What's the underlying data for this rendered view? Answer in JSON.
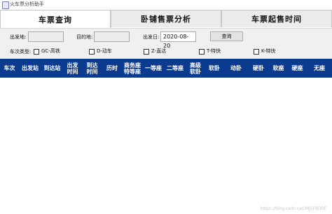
{
  "window": {
    "title": "火车票分析助手"
  },
  "tabs": [
    {
      "label": "车票查询",
      "active": true
    },
    {
      "label": "卧铺售票分析",
      "active": false
    },
    {
      "label": "车票起售时间",
      "active": false
    }
  ],
  "query": {
    "from_label": "出发地:",
    "from_value": "",
    "to_label": "目的地:",
    "to_value": "",
    "date_label": "出发日:",
    "date_value": "2020-08-20",
    "search_button": "查询",
    "type_label": "车次类型:",
    "train_types": [
      {
        "label": "GC-高铁",
        "checked": false
      },
      {
        "label": "D-动车",
        "checked": false
      },
      {
        "label": "Z-直达",
        "checked": false
      },
      {
        "label": "T-特快",
        "checked": false
      },
      {
        "label": "K-特快",
        "checked": false
      }
    ]
  },
  "table": {
    "header_color": "#0b3b8f",
    "columns": [
      "车次",
      "出发站",
      "到达站",
      "出发\n时间",
      "到达\n时间",
      "历时",
      "商务座\n特等座",
      "一等座",
      "二等座",
      "高级\n软卧",
      "软卧",
      "动卧",
      "硬卧",
      "软座",
      "硬座",
      "无座"
    ],
    "rows": []
  },
  "watermark": "https://blog.csdn.net/MJ5F9DRF"
}
